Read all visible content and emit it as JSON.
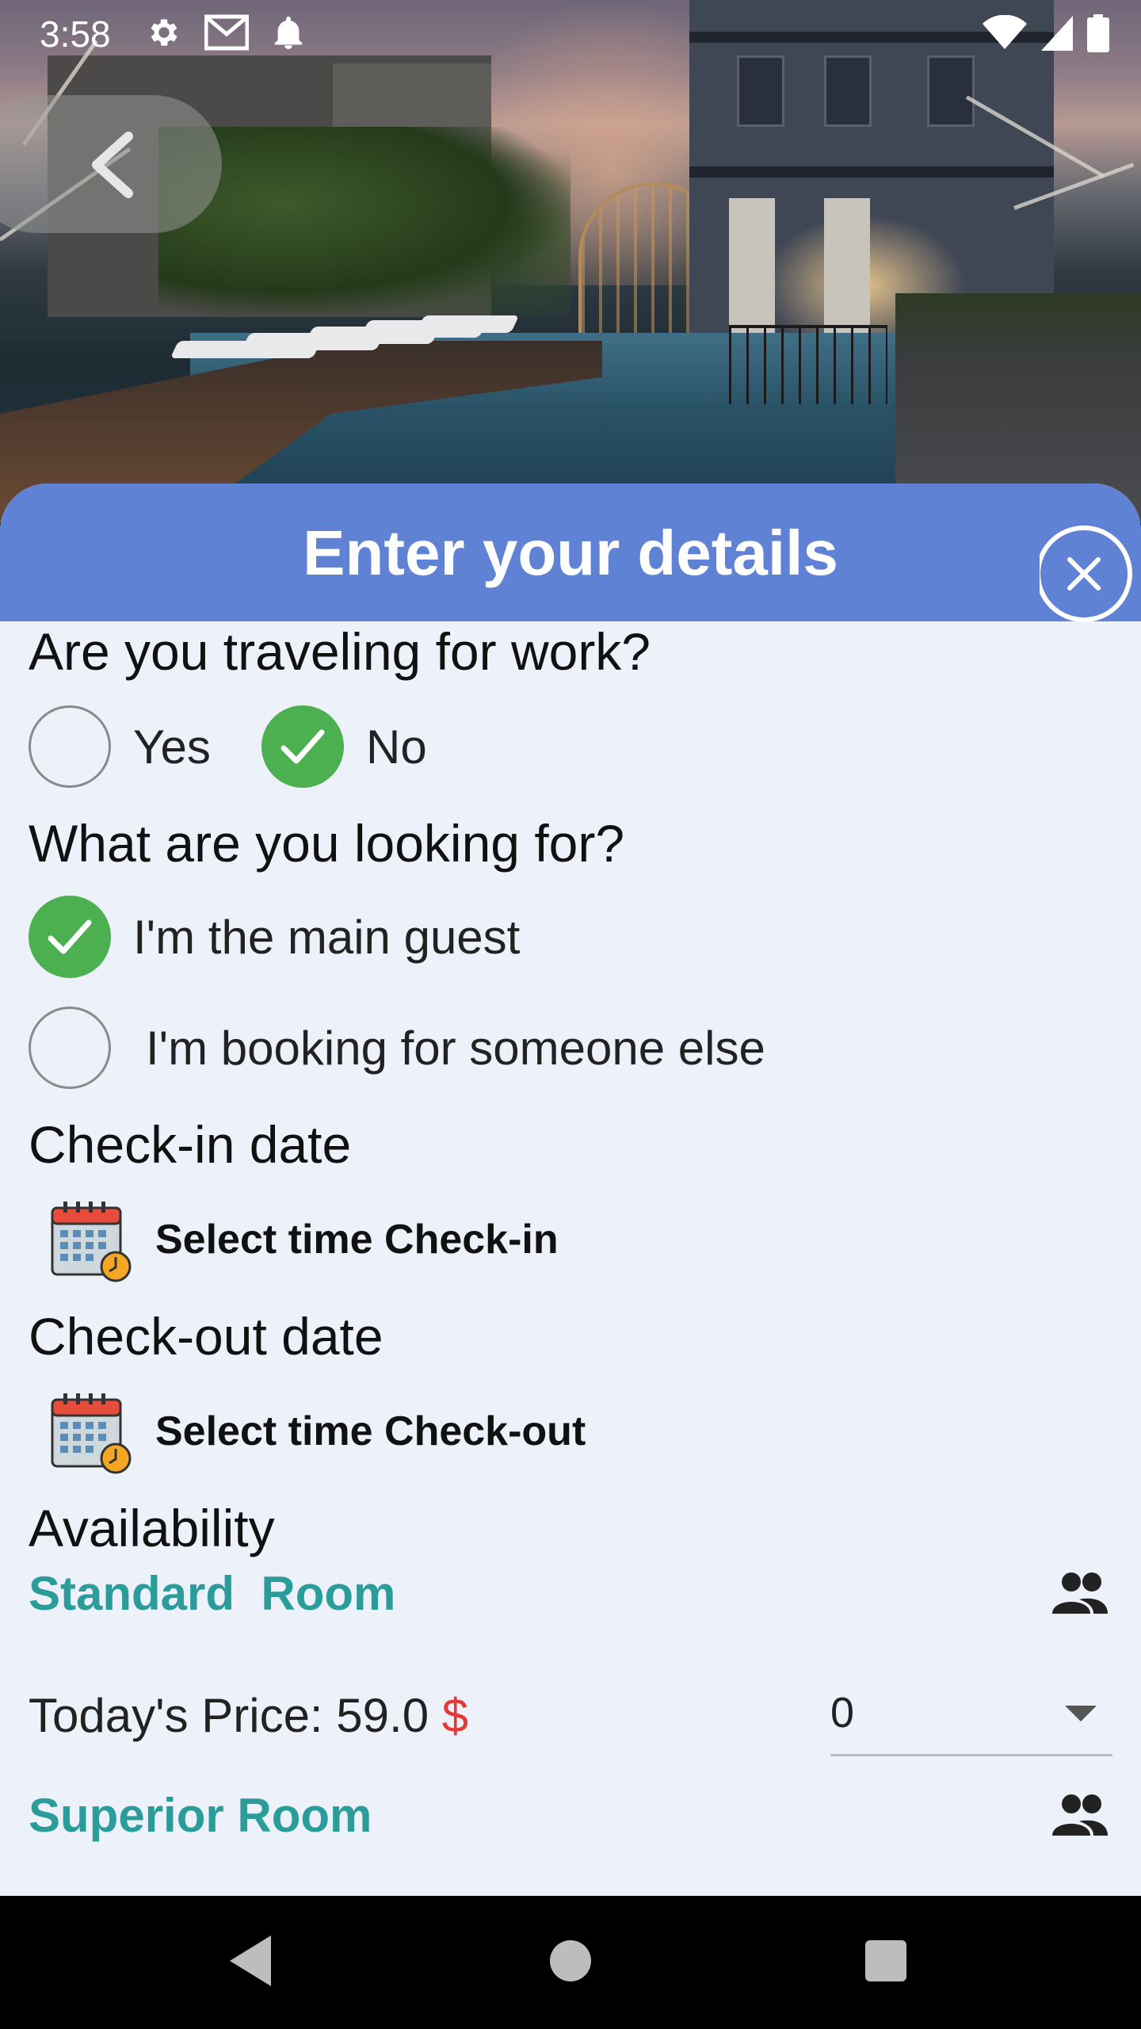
{
  "status_bar": {
    "time": "3:58"
  },
  "sheet": {
    "title": "Enter your details",
    "work_question": "Are you traveling for work?",
    "work_options": [
      {
        "label": "Yes",
        "checked": false
      },
      {
        "label": "No",
        "checked": true
      }
    ],
    "looking_question": "What are you looking for?",
    "looking_options": [
      {
        "label": "I'm the main guest",
        "checked": true
      },
      {
        "label": "I'm booking for someone else",
        "checked": false
      }
    ],
    "checkin_label": "Check-in date",
    "checkin_select": "Select time Check-in",
    "checkout_label": "Check-out date",
    "checkout_select": "Select time Check-out",
    "availability_label": "Availability",
    "rooms": [
      {
        "name": "Standard  Room",
        "price_prefix": "Today's Price: ",
        "price": "59.0",
        "currency": "$",
        "quantity": "0"
      },
      {
        "name": "Superior Room"
      }
    ]
  },
  "colors": {
    "header": "#5f82d4",
    "sheet_bg": "#ecf1fa",
    "accent_teal": "#2a9d9b",
    "check_green": "#4caf50",
    "currency_red": "#e53935"
  },
  "icons": [
    "settings-icon",
    "gmail-icon",
    "notification-bell-icon",
    "wifi-icon",
    "cell-signal-icon",
    "battery-icon",
    "back-chevron-icon",
    "close-circle-icon",
    "calendar-clock-icon",
    "people-icon",
    "checkmark-icon"
  ]
}
